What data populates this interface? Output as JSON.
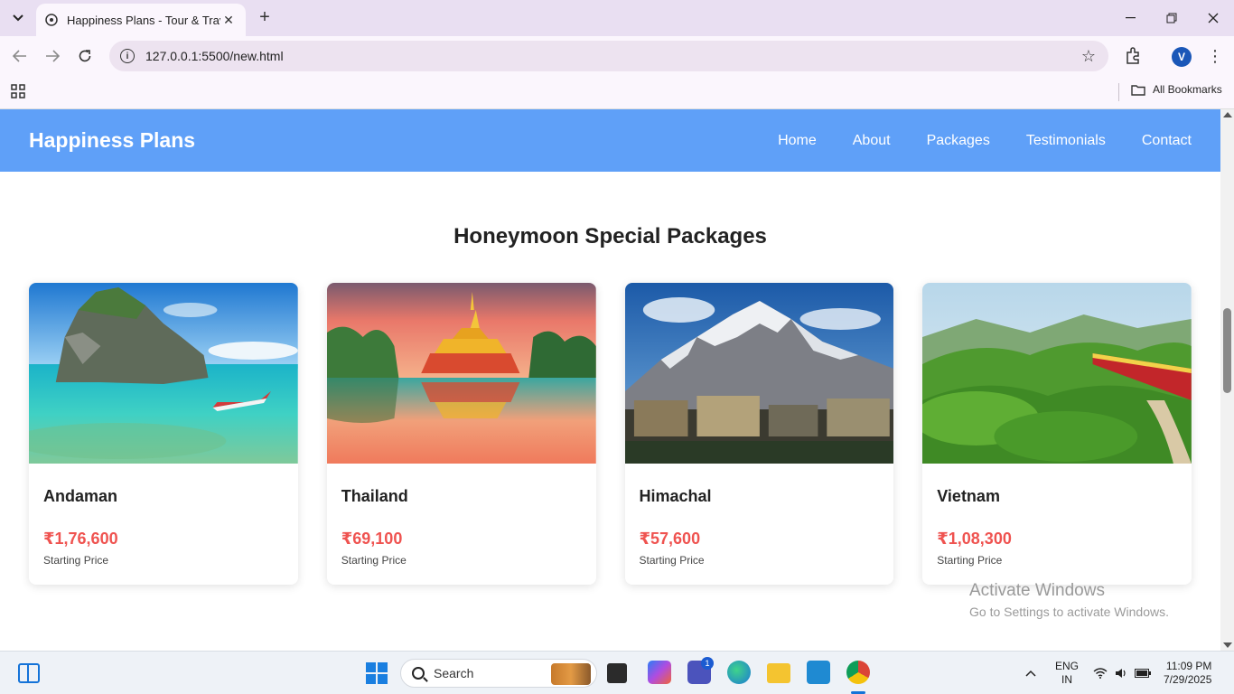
{
  "browser": {
    "tab_title": "Happiness Plans - Tour & Travel",
    "url": "127.0.0.1:5500/new.html",
    "bookmarks_label": "All Bookmarks",
    "profile_initial": "V"
  },
  "site": {
    "logo": "Happiness Plans",
    "nav": [
      "Home",
      "About",
      "Packages",
      "Testimonials",
      "Contact"
    ],
    "section_title": "Honeymoon Special Packages",
    "packages": [
      {
        "name": "Andaman",
        "price": "₹1,76,600",
        "caption": "Starting Price"
      },
      {
        "name": "Thailand",
        "price": "₹69,100",
        "caption": "Starting Price"
      },
      {
        "name": "Himachal",
        "price": "₹57,600",
        "caption": "Starting Price"
      },
      {
        "name": "Vietnam",
        "price": "₹1,08,300",
        "caption": "Starting Price"
      }
    ],
    "accent_color": "#5fa0f8",
    "price_color": "#ef5350"
  },
  "watermark": {
    "line1": "Activate Windows",
    "line2": "Go to Settings to activate Windows."
  },
  "taskbar": {
    "search_placeholder": "Search",
    "teams_badge": "1",
    "lang_line1": "ENG",
    "lang_line2": "IN",
    "time": "11:09 PM",
    "date": "7/29/2025"
  }
}
